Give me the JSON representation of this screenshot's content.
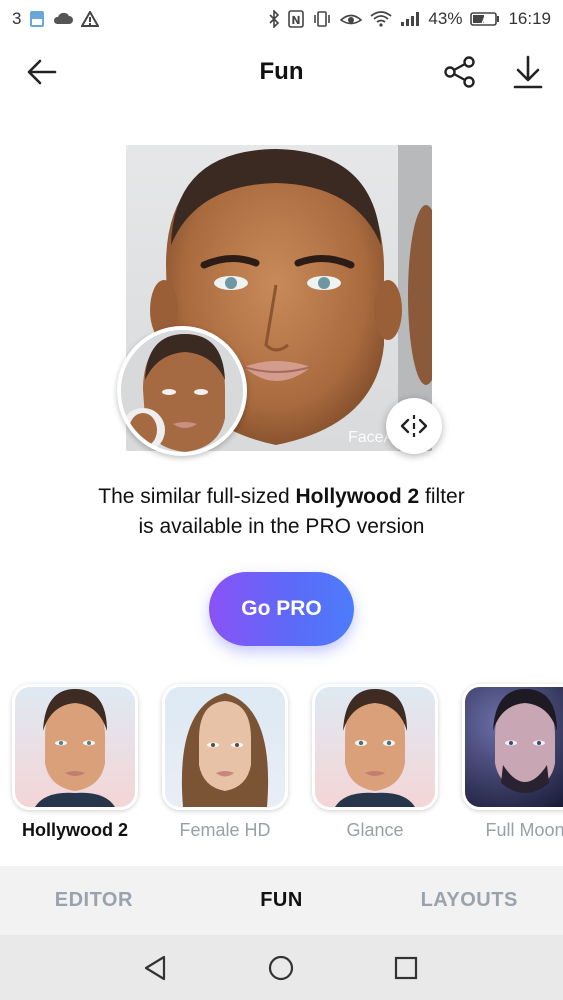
{
  "status_bar": {
    "sim_label": "3",
    "battery": "43%",
    "time": "16:19"
  },
  "app_bar": {
    "title": "Fun",
    "icons": [
      "back-arrow-icon",
      "share-icon",
      "download-icon"
    ]
  },
  "preview": {
    "watermark": "FaceApp"
  },
  "message": {
    "prefix": "The similar full-sized ",
    "filter_name": "Hollywood 2",
    "suffix": " filter",
    "line2": "is available in the PRO version"
  },
  "go_pro": {
    "label": "Go PRO"
  },
  "filters": [
    {
      "label": "Hollywood 2",
      "active": true
    },
    {
      "label": "Female HD",
      "active": false
    },
    {
      "label": "Glance",
      "active": false
    },
    {
      "label": "Full Moon",
      "active": false
    }
  ],
  "tabs": [
    {
      "label": "EDITOR",
      "active": false
    },
    {
      "label": "FUN",
      "active": true
    },
    {
      "label": "LAYOUTS",
      "active": false
    }
  ],
  "colors": {
    "accent_start": "#8a52f6",
    "accent_end": "#4d7cfa",
    "tab_inactive": "#9aa3ad"
  }
}
